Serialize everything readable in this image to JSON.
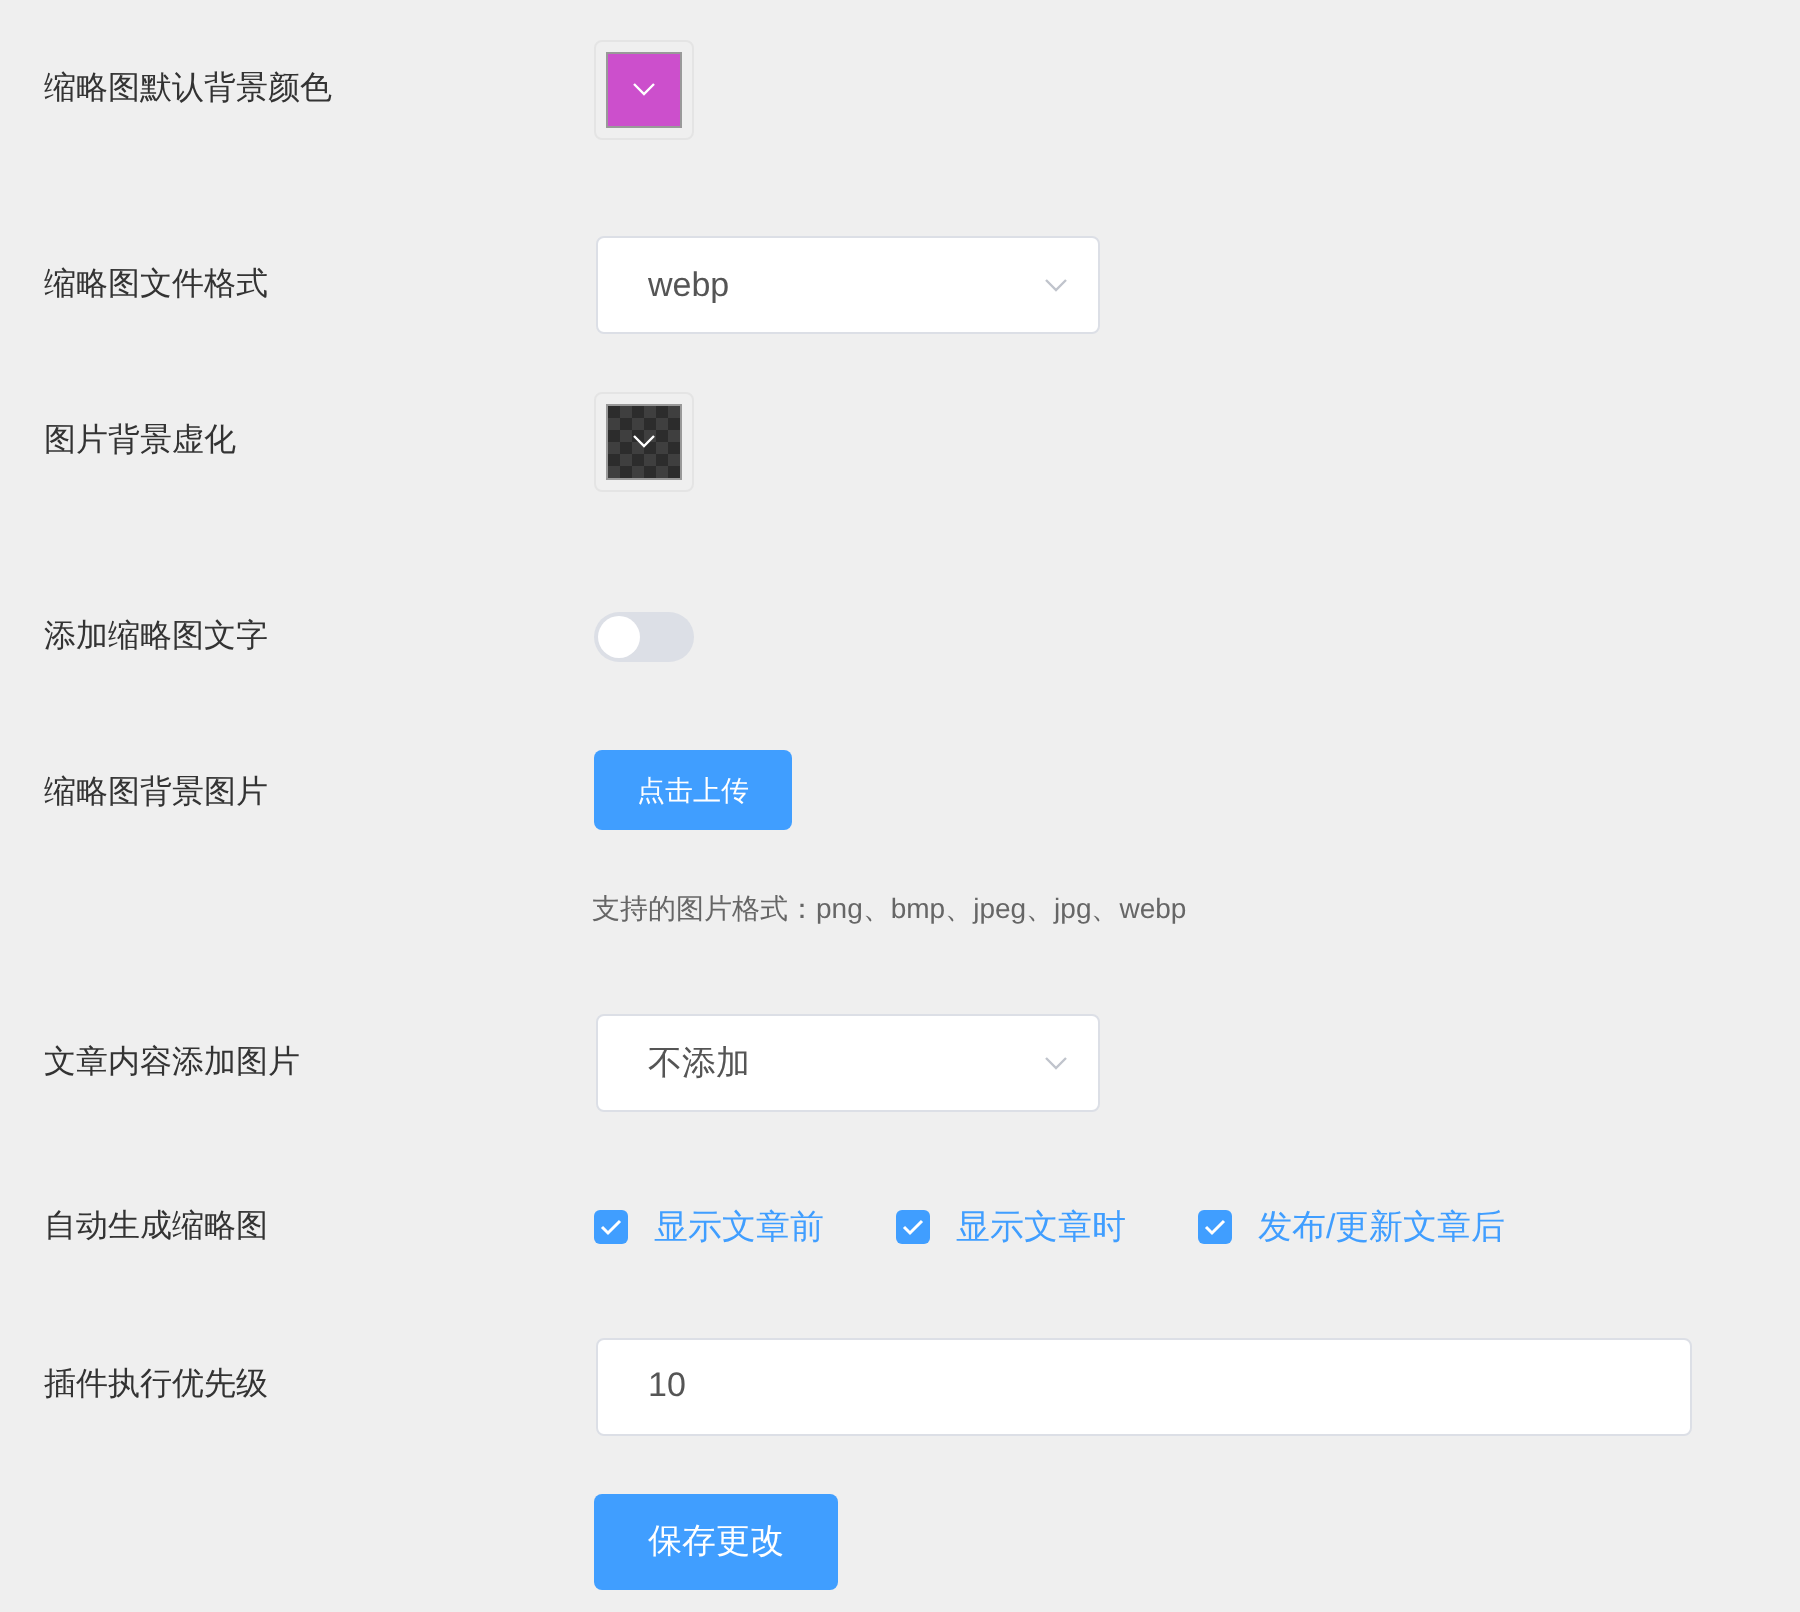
{
  "rows": [
    {
      "kind": "color",
      "label": "缩略图默认背景颜色",
      "color": "#cc4fcc"
    },
    {
      "kind": "select",
      "label": "缩略图文件格式",
      "value": "webp"
    },
    {
      "kind": "transparent",
      "label": "图片背景虚化"
    },
    {
      "kind": "switch",
      "label": "添加缩略图文字",
      "on": false
    },
    {
      "kind": "upload",
      "label": "缩略图背景图片",
      "button": "点击上传",
      "help": "支持的图片格式：png、bmp、jpeg、jpg、webp"
    },
    {
      "kind": "select",
      "label": "文章内容添加图片",
      "value": "不添加"
    },
    {
      "kind": "checkboxes",
      "label": "自动生成缩略图",
      "options": [
        {
          "label": "显示文章前",
          "checked": true
        },
        {
          "label": "显示文章时",
          "checked": true
        },
        {
          "label": "发布/更新文章后",
          "checked": true
        }
      ]
    },
    {
      "kind": "input",
      "label": "插件执行优先级",
      "value": "10"
    }
  ],
  "save_button": "保存更改"
}
